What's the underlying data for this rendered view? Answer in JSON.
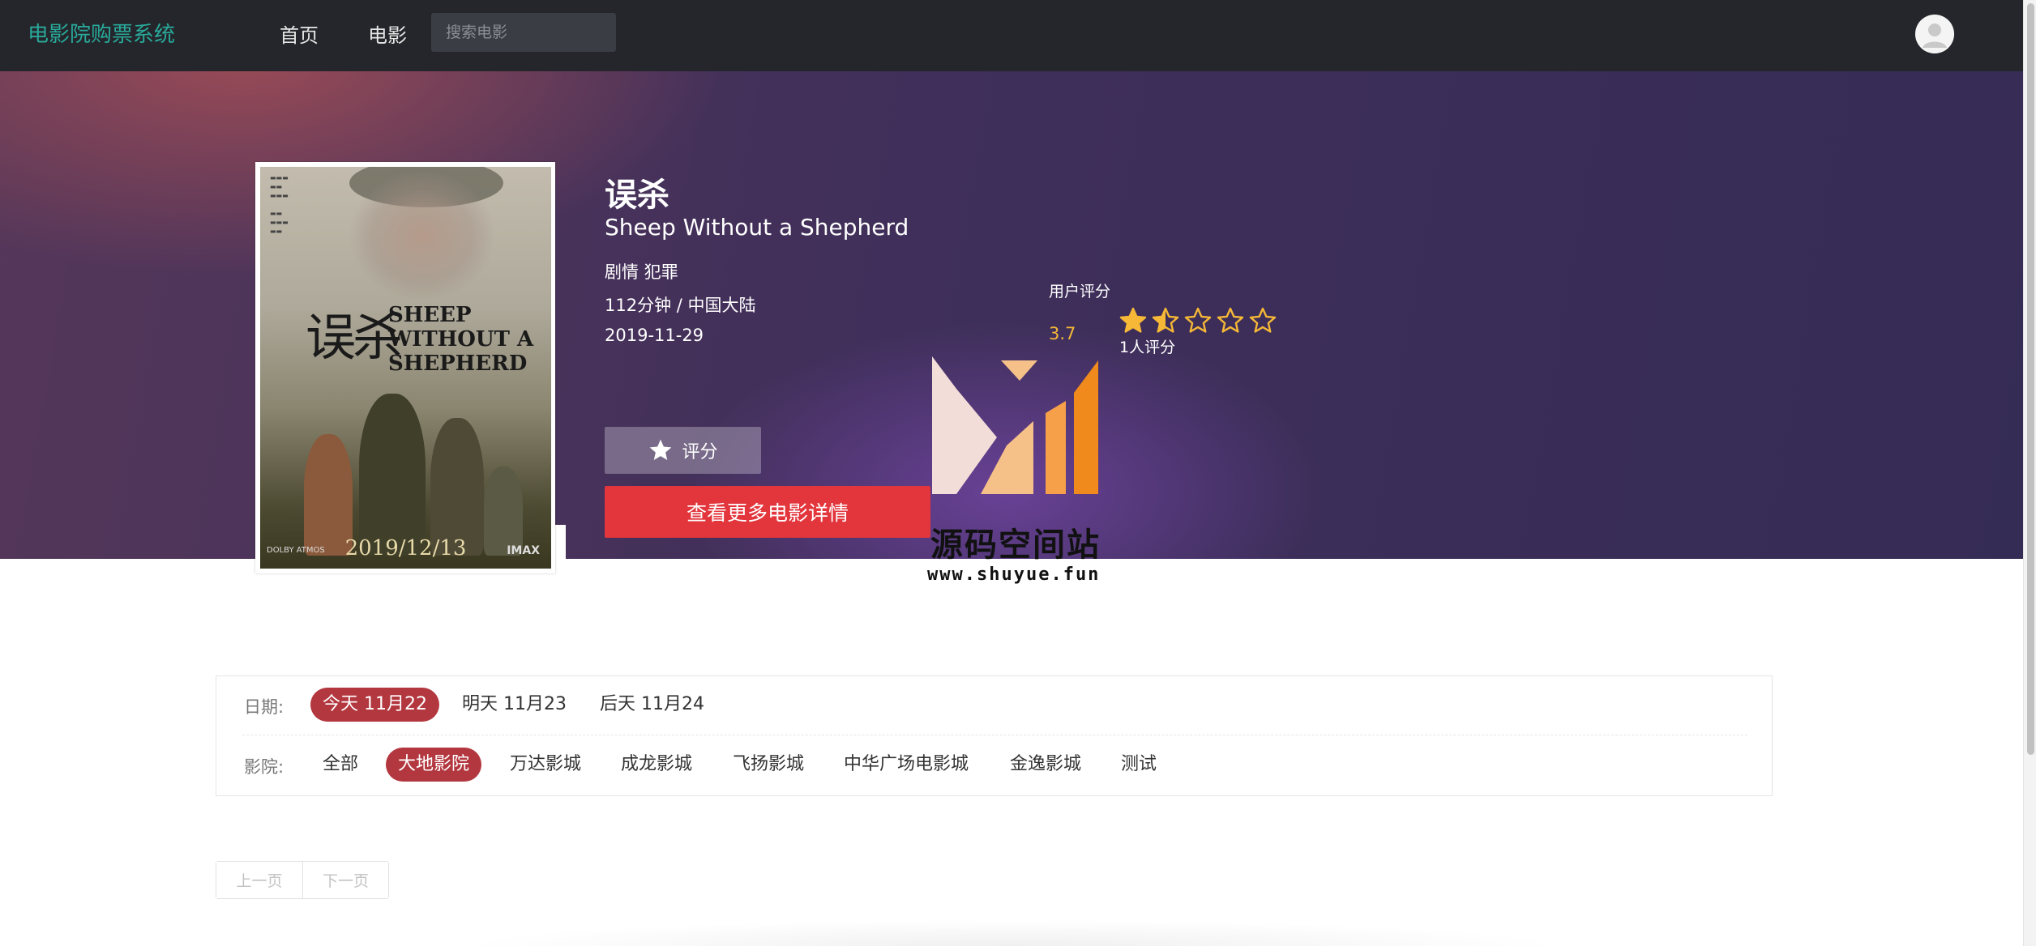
{
  "nav": {
    "brand": "电影院购票系统",
    "home": "首页",
    "movies": "电影",
    "search_placeholder": "搜索电影"
  },
  "movie": {
    "title": "误杀",
    "title_en": "Sheep Without a Shepherd",
    "genres": "剧情 犯罪",
    "length_region": "112分钟 / 中国大陆",
    "release_date": "2019-11-29",
    "rate_button": "评分",
    "detail_button": "查看更多电影详情"
  },
  "rating": {
    "label": "用户评分",
    "score": "3.7",
    "stars_filled": 1.5,
    "stars_total": 5,
    "count": "1人评分",
    "star_color": "#f6b836"
  },
  "poster": {
    "title_cn": "误杀",
    "title_en": "SHEEP WITHOUT A SHEPHERD",
    "date": "2019/12/13",
    "left_logo": "DOLBY ATMOS",
    "right_logo": "IMAX"
  },
  "watermark": {
    "name": "源码空间站",
    "url": "www.shuyue.fun"
  },
  "filter": {
    "date_label": "日期:",
    "dates": [
      {
        "label": "今天 11月22",
        "active": true
      },
      {
        "label": "明天 11月23",
        "active": false
      },
      {
        "label": "后天 11月24",
        "active": false
      }
    ],
    "cinema_label": "影院:",
    "cinemas": [
      {
        "label": "全部",
        "active": false
      },
      {
        "label": "大地影院",
        "active": true
      },
      {
        "label": "万达影城",
        "active": false
      },
      {
        "label": "成龙影城",
        "active": false
      },
      {
        "label": "飞扬影城",
        "active": false
      },
      {
        "label": "中华广场电影城",
        "active": false
      },
      {
        "label": "金逸影城",
        "active": false
      },
      {
        "label": "测试",
        "active": false
      }
    ],
    "active_color": "#b3373f"
  },
  "pagination": {
    "prev": "上一页",
    "next": "下一页"
  },
  "colors": {
    "nav_bg": "#24262b",
    "brand": "#29a99a",
    "detail_button": "#e3353c"
  }
}
